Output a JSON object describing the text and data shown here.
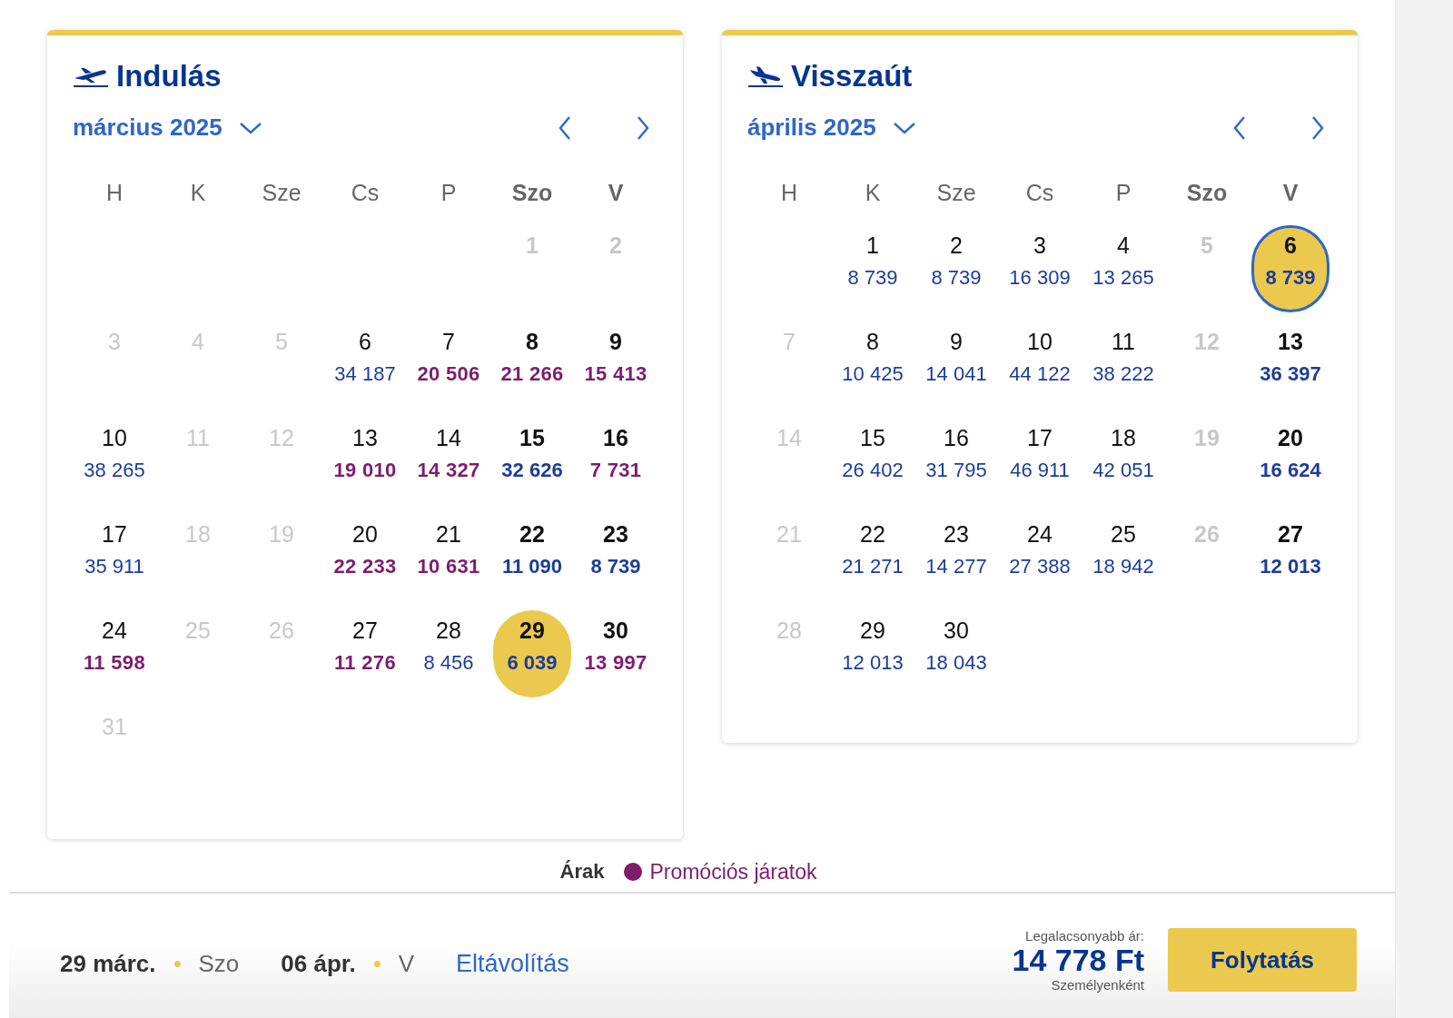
{
  "calendars": [
    {
      "title": "Indulás",
      "month": "március 2025",
      "weekdays": [
        {
          "label": "H",
          "weekend": false
        },
        {
          "label": "K",
          "weekend": false
        },
        {
          "label": "Sze",
          "weekend": false
        },
        {
          "label": "Cs",
          "weekend": false
        },
        {
          "label": "P",
          "weekend": false
        },
        {
          "label": "Szo",
          "weekend": true
        },
        {
          "label": "V",
          "weekend": true
        }
      ],
      "days": [
        {
          "kind": "blank"
        },
        {
          "kind": "blank"
        },
        {
          "kind": "blank"
        },
        {
          "kind": "blank"
        },
        {
          "kind": "blank"
        },
        {
          "kind": "day",
          "day": "1",
          "disabled": true,
          "selected": false,
          "focused": false
        },
        {
          "kind": "day",
          "day": "2",
          "disabled": true,
          "selected": false,
          "focused": false
        },
        {
          "kind": "day",
          "day": "3",
          "disabled": true,
          "selected": false,
          "focused": false
        },
        {
          "kind": "day",
          "day": "4",
          "disabled": true,
          "selected": false,
          "focused": false
        },
        {
          "kind": "day",
          "day": "5",
          "disabled": true,
          "selected": false,
          "focused": false
        },
        {
          "kind": "day",
          "day": "6",
          "price": "34 187",
          "disabled": false,
          "promo": false,
          "selected": false,
          "focused": false
        },
        {
          "kind": "day",
          "day": "7",
          "price": "20 506",
          "disabled": false,
          "promo": true,
          "selected": false,
          "focused": false
        },
        {
          "kind": "day",
          "day": "8",
          "price": "21 266",
          "disabled": false,
          "promo": true,
          "selected": false,
          "focused": false
        },
        {
          "kind": "day",
          "day": "9",
          "price": "15 413",
          "disabled": false,
          "promo": true,
          "selected": false,
          "focused": false
        },
        {
          "kind": "day",
          "day": "10",
          "price": "38 265",
          "disabled": false,
          "promo": false,
          "selected": false,
          "focused": false
        },
        {
          "kind": "day",
          "day": "11",
          "disabled": true,
          "selected": false,
          "focused": false
        },
        {
          "kind": "day",
          "day": "12",
          "disabled": true,
          "selected": false,
          "focused": false
        },
        {
          "kind": "day",
          "day": "13",
          "price": "19 010",
          "disabled": false,
          "promo": true,
          "selected": false,
          "focused": false
        },
        {
          "kind": "day",
          "day": "14",
          "price": "14 327",
          "disabled": false,
          "promo": true,
          "selected": false,
          "focused": false
        },
        {
          "kind": "day",
          "day": "15",
          "price": "32 626",
          "disabled": false,
          "promo": false,
          "selected": false,
          "focused": false
        },
        {
          "kind": "day",
          "day": "16",
          "price": "7 731",
          "disabled": false,
          "promo": true,
          "selected": false,
          "focused": false
        },
        {
          "kind": "day",
          "day": "17",
          "price": "35 911",
          "disabled": false,
          "promo": false,
          "selected": false,
          "focused": false
        },
        {
          "kind": "day",
          "day": "18",
          "disabled": true,
          "selected": false,
          "focused": false
        },
        {
          "kind": "day",
          "day": "19",
          "disabled": true,
          "selected": false,
          "focused": false
        },
        {
          "kind": "day",
          "day": "20",
          "price": "22 233",
          "disabled": false,
          "promo": true,
          "selected": false,
          "focused": false
        },
        {
          "kind": "day",
          "day": "21",
          "price": "10 631",
          "disabled": false,
          "promo": true,
          "selected": false,
          "focused": false
        },
        {
          "kind": "day",
          "day": "22",
          "price": "11 090",
          "disabled": false,
          "promo": false,
          "selected": false,
          "focused": false
        },
        {
          "kind": "day",
          "day": "23",
          "price": "8 739",
          "disabled": false,
          "promo": false,
          "selected": false,
          "focused": false
        },
        {
          "kind": "day",
          "day": "24",
          "price": "11 598",
          "disabled": false,
          "promo": true,
          "selected": false,
          "focused": false
        },
        {
          "kind": "day",
          "day": "25",
          "disabled": true,
          "selected": false,
          "focused": false
        },
        {
          "kind": "day",
          "day": "26",
          "disabled": true,
          "selected": false,
          "focused": false
        },
        {
          "kind": "day",
          "day": "27",
          "price": "11 276",
          "disabled": false,
          "promo": true,
          "selected": false,
          "focused": false
        },
        {
          "kind": "day",
          "day": "28",
          "price": "8 456",
          "disabled": false,
          "promo": false,
          "selected": false,
          "focused": false
        },
        {
          "kind": "day",
          "day": "29",
          "price": "6 039",
          "disabled": false,
          "promo": false,
          "selected": true,
          "focused": false
        },
        {
          "kind": "day",
          "day": "30",
          "price": "13 997",
          "disabled": false,
          "promo": true,
          "selected": false,
          "focused": false
        },
        {
          "kind": "day",
          "day": "31",
          "disabled": true,
          "selected": false,
          "focused": false
        }
      ]
    },
    {
      "title": "Visszaút",
      "month": "április 2025",
      "weekdays": [
        {
          "label": "H",
          "weekend": false
        },
        {
          "label": "K",
          "weekend": false
        },
        {
          "label": "Sze",
          "weekend": false
        },
        {
          "label": "Cs",
          "weekend": false
        },
        {
          "label": "P",
          "weekend": false
        },
        {
          "label": "Szo",
          "weekend": true
        },
        {
          "label": "V",
          "weekend": true
        }
      ],
      "days": [
        {
          "kind": "blank"
        },
        {
          "kind": "day",
          "day": "1",
          "price": "8 739",
          "disabled": false,
          "promo": false,
          "selected": false,
          "focused": false
        },
        {
          "kind": "day",
          "day": "2",
          "price": "8 739",
          "disabled": false,
          "promo": false,
          "selected": false,
          "focused": false
        },
        {
          "kind": "day",
          "day": "3",
          "price": "16 309",
          "disabled": false,
          "promo": false,
          "selected": false,
          "focused": false
        },
        {
          "kind": "day",
          "day": "4",
          "price": "13 265",
          "disabled": false,
          "promo": false,
          "selected": false,
          "focused": false
        },
        {
          "kind": "day",
          "day": "5",
          "disabled": true,
          "selected": false,
          "focused": false
        },
        {
          "kind": "day",
          "day": "6",
          "price": "8 739",
          "disabled": false,
          "promo": false,
          "selected": true,
          "focused": true
        },
        {
          "kind": "day",
          "day": "7",
          "disabled": true,
          "selected": false,
          "focused": false
        },
        {
          "kind": "day",
          "day": "8",
          "price": "10 425",
          "disabled": false,
          "promo": false,
          "selected": false,
          "focused": false
        },
        {
          "kind": "day",
          "day": "9",
          "price": "14 041",
          "disabled": false,
          "promo": false,
          "selected": false,
          "focused": false
        },
        {
          "kind": "day",
          "day": "10",
          "price": "44 122",
          "disabled": false,
          "promo": false,
          "selected": false,
          "focused": false
        },
        {
          "kind": "day",
          "day": "11",
          "price": "38 222",
          "disabled": false,
          "promo": false,
          "selected": false,
          "focused": false
        },
        {
          "kind": "day",
          "day": "12",
          "disabled": true,
          "selected": false,
          "focused": false
        },
        {
          "kind": "day",
          "day": "13",
          "price": "36 397",
          "disabled": false,
          "promo": false,
          "selected": false,
          "focused": false
        },
        {
          "kind": "day",
          "day": "14",
          "disabled": true,
          "selected": false,
          "focused": false
        },
        {
          "kind": "day",
          "day": "15",
          "price": "26 402",
          "disabled": false,
          "promo": false,
          "selected": false,
          "focused": false
        },
        {
          "kind": "day",
          "day": "16",
          "price": "31 795",
          "disabled": false,
          "promo": false,
          "selected": false,
          "focused": false
        },
        {
          "kind": "day",
          "day": "17",
          "price": "46 911",
          "disabled": false,
          "promo": false,
          "selected": false,
          "focused": false
        },
        {
          "kind": "day",
          "day": "18",
          "price": "42 051",
          "disabled": false,
          "promo": false,
          "selected": false,
          "focused": false
        },
        {
          "kind": "day",
          "day": "19",
          "disabled": true,
          "selected": false,
          "focused": false
        },
        {
          "kind": "day",
          "day": "20",
          "price": "16 624",
          "disabled": false,
          "promo": false,
          "selected": false,
          "focused": false
        },
        {
          "kind": "day",
          "day": "21",
          "disabled": true,
          "selected": false,
          "focused": false
        },
        {
          "kind": "day",
          "day": "22",
          "price": "21 271",
          "disabled": false,
          "promo": false,
          "selected": false,
          "focused": false
        },
        {
          "kind": "day",
          "day": "23",
          "price": "14 277",
          "disabled": false,
          "promo": false,
          "selected": false,
          "focused": false
        },
        {
          "kind": "day",
          "day": "24",
          "price": "27 388",
          "disabled": false,
          "promo": false,
          "selected": false,
          "focused": false
        },
        {
          "kind": "day",
          "day": "25",
          "price": "18 942",
          "disabled": false,
          "promo": false,
          "selected": false,
          "focused": false
        },
        {
          "kind": "day",
          "day": "26",
          "disabled": true,
          "selected": false,
          "focused": false
        },
        {
          "kind": "day",
          "day": "27",
          "price": "12 013",
          "disabled": false,
          "promo": false,
          "selected": false,
          "focused": false
        },
        {
          "kind": "day",
          "day": "28",
          "disabled": true,
          "selected": false,
          "focused": false
        },
        {
          "kind": "day",
          "day": "29",
          "price": "12 013",
          "disabled": false,
          "promo": false,
          "selected": false,
          "focused": false
        },
        {
          "kind": "day",
          "day": "30",
          "price": "18 043",
          "disabled": false,
          "promo": false,
          "selected": false,
          "focused": false
        }
      ]
    }
  ],
  "legend": {
    "label": "Árak",
    "items": [
      {
        "label": "Promóciós járatok",
        "color": "#7d1d6e"
      }
    ]
  },
  "footer": {
    "dates": [
      {
        "date": "29 márc.",
        "weekday": "Szo"
      },
      {
        "date": "06 ápr.",
        "weekday": "V"
      }
    ],
    "remove_link": "Eltávolítás",
    "price_caption": "Legalacsonyabb ár:",
    "price": "14 778 Ft",
    "price_note": "Személyenként",
    "continue_button": "Folytatás"
  }
}
